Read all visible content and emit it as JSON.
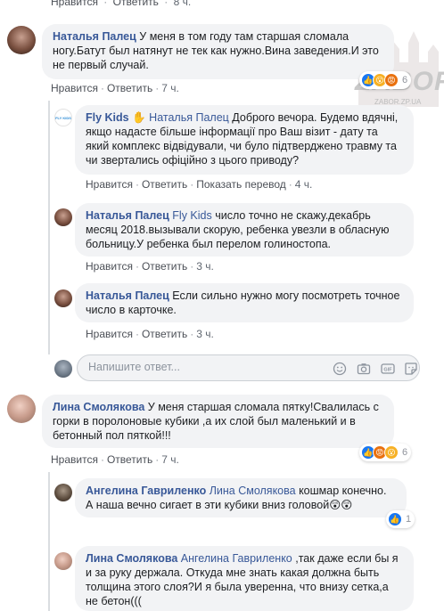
{
  "top_actions": {
    "like": "Нравится",
    "reply": "Ответить",
    "time": "8 ч."
  },
  "watermark": {
    "brand": "ZABOR",
    "url": "ZABOR.ZP.UA"
  },
  "comments": [
    {
      "author": "Наталья Палец",
      "text": "У меня в том году там старшая сломала ногу.Батут был натянут не тек как нужно.Вина заведения.И это не первый случай.",
      "like": "Нравится",
      "reply": "Ответить",
      "time": "7 ч.",
      "reactions": {
        "count": "6",
        "types": [
          "like-icon",
          "wow-icon",
          "angry-icon"
        ]
      }
    },
    {
      "author": "Fly Kids",
      "mention": "Наталья Палец",
      "text": "Доброго вечора. Будемо вдячні, якщо надасте більше інформації про Ваш візит - дату та який комплекс відвідували, чи було підтверджено травму та чи звертались офіційно з цього приводу?",
      "like": "Нравится",
      "reply": "Ответить",
      "translate": "Показать перевод",
      "time": "4 ч.",
      "logo_text": "FLY KIDS"
    },
    {
      "author": "Наталья Палец",
      "mention": "Fly Kids",
      "text": "число точно не скажу.декабрь месяц 2018.вызывали скорую, ребенка увезли в обласную больницу.У ребенка был перелом голиностопа.",
      "like": "Нравится",
      "reply": "Ответить",
      "time": "3 ч."
    },
    {
      "author": "Наталья Палец",
      "text": "Если сильно нужно могу посмотреть точное число в карточке.",
      "like": "Нравится",
      "reply": "Ответить",
      "time": "3 ч."
    },
    {
      "author": "Лина Смолякова",
      "text": "У меня старшая сломала пятку!Свалилась с горки в поролоновые кубики ,а их слой был маленький и в бетонный пол пяткой!!!",
      "like": "Нравится",
      "reply": "Ответить",
      "time": "7 ч.",
      "reactions": {
        "count": "6",
        "types": [
          "like-icon",
          "angry-icon",
          "wow-icon"
        ]
      }
    },
    {
      "author": "Ангелина Гавриленко",
      "mention": "Лина Смолякова",
      "text": "кошмар конечно. А наша вечно сигает в эти кубики вниз головой",
      "emoji": "😲😲",
      "reactions": {
        "count": "1",
        "types": [
          "like-icon"
        ]
      }
    },
    {
      "author": "Лина Смолякова",
      "mention": "Ангелина Гавриленко",
      "text": ",так даже если бы я и за руку держала. Откуда мне знать какая должна быть толщина этого слоя?И я была уверенна, что внизу сетка,а не бетон((("
    }
  ],
  "reply_box": {
    "placeholder": "Напишите ответ..."
  },
  "colors": {
    "link": "#385898",
    "bubble": "#f2f3f5",
    "like": "#1877f2",
    "wow": "#f7b125",
    "angry": "#e9710f"
  }
}
